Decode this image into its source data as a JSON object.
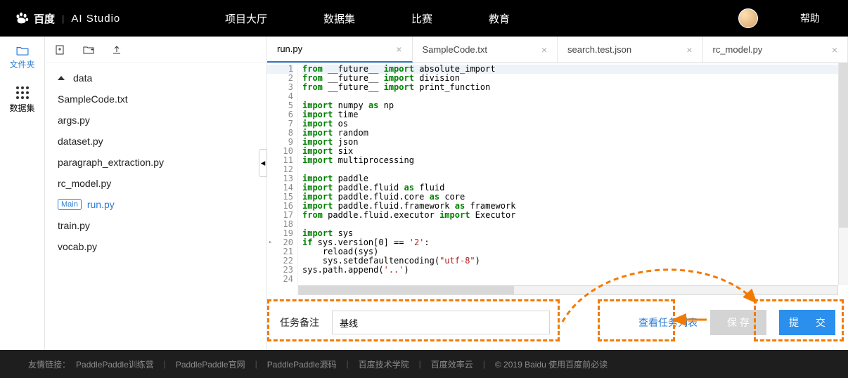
{
  "header": {
    "logo_main": "百度",
    "logo_sub": "AI Studio",
    "nav": [
      "项目大厅",
      "数据集",
      "比赛",
      "教育"
    ],
    "help": "帮助"
  },
  "rail": {
    "files": "文件夹",
    "dataset": "数据集"
  },
  "files": {
    "folder": "data",
    "items": [
      "SampleCode.txt",
      "args.py",
      "dataset.py",
      "paragraph_extraction.py",
      "rc_model.py",
      "run.py",
      "train.py",
      "vocab.py"
    ],
    "main_badge": "Main",
    "open": "run.py"
  },
  "tabs": [
    {
      "label": "run.py",
      "active": true
    },
    {
      "label": "SampleCode.txt"
    },
    {
      "label": "search.test.json"
    },
    {
      "label": "rc_model.py"
    }
  ],
  "code": {
    "lines": [
      {
        "n": 1,
        "t": "from __future__ import absolute_import"
      },
      {
        "n": 2,
        "t": "from __future__ import division"
      },
      {
        "n": 3,
        "t": "from __future__ import print_function"
      },
      {
        "n": 4,
        "t": ""
      },
      {
        "n": 5,
        "t": "import numpy as np"
      },
      {
        "n": 6,
        "t": "import time"
      },
      {
        "n": 7,
        "t": "import os"
      },
      {
        "n": 8,
        "t": "import random"
      },
      {
        "n": 9,
        "t": "import json"
      },
      {
        "n": 10,
        "t": "import six"
      },
      {
        "n": 11,
        "t": "import multiprocessing"
      },
      {
        "n": 12,
        "t": ""
      },
      {
        "n": 13,
        "t": "import paddle"
      },
      {
        "n": 14,
        "t": "import paddle.fluid as fluid"
      },
      {
        "n": 15,
        "t": "import paddle.fluid.core as core"
      },
      {
        "n": 16,
        "t": "import paddle.fluid.framework as framework"
      },
      {
        "n": 17,
        "t": "from paddle.fluid.executor import Executor"
      },
      {
        "n": 18,
        "t": ""
      },
      {
        "n": 19,
        "t": "import sys"
      },
      {
        "n": 20,
        "t": "if sys.version[0] == '2':"
      },
      {
        "n": 21,
        "t": "    reload(sys)"
      },
      {
        "n": 22,
        "t": "    sys.setdefaultencoding(\"utf-8\")"
      },
      {
        "n": 23,
        "t": "sys.path.append('..')"
      },
      {
        "n": 24,
        "t": ""
      }
    ]
  },
  "bottom": {
    "task_label": "任务备注",
    "task_value": "基线",
    "view_tasks": "查看任务列表",
    "save": "保 存",
    "submit": "提 交"
  },
  "footer": {
    "prefix": "友情链接：",
    "links": [
      "PaddlePaddle训练营",
      "PaddlePaddle官网",
      "PaddlePaddle源码",
      "百度技术学院",
      "百度效率云"
    ],
    "copyright": "© 2019 Baidu 使用百度前必读"
  }
}
